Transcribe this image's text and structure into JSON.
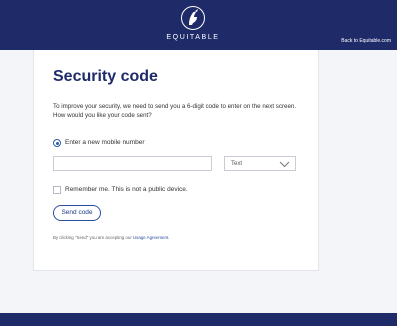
{
  "header": {
    "brand": "EQUITABLE",
    "back_link": "Back to Equitable.com"
  },
  "card": {
    "title": "Security code",
    "intro": "To improve your security, we need to send you a 6-digit code to enter on the next screen. How would you like your code sent?",
    "radio_label": "Enter a new mobile number",
    "phone_value": "",
    "method_selected": "Text",
    "remember_label": "Remember me. This is not a public device.",
    "send_button": "Send code",
    "legal_prefix": "By clicking \"Send\" you are accepting our",
    "legal_link": "Usage Agreement",
    "legal_suffix": "."
  },
  "colors": {
    "brand_navy": "#1f2b69",
    "accent_blue": "#2b5ea7"
  },
  "icons": [
    "equitable-logo-icon",
    "chevron-down-icon"
  ]
}
